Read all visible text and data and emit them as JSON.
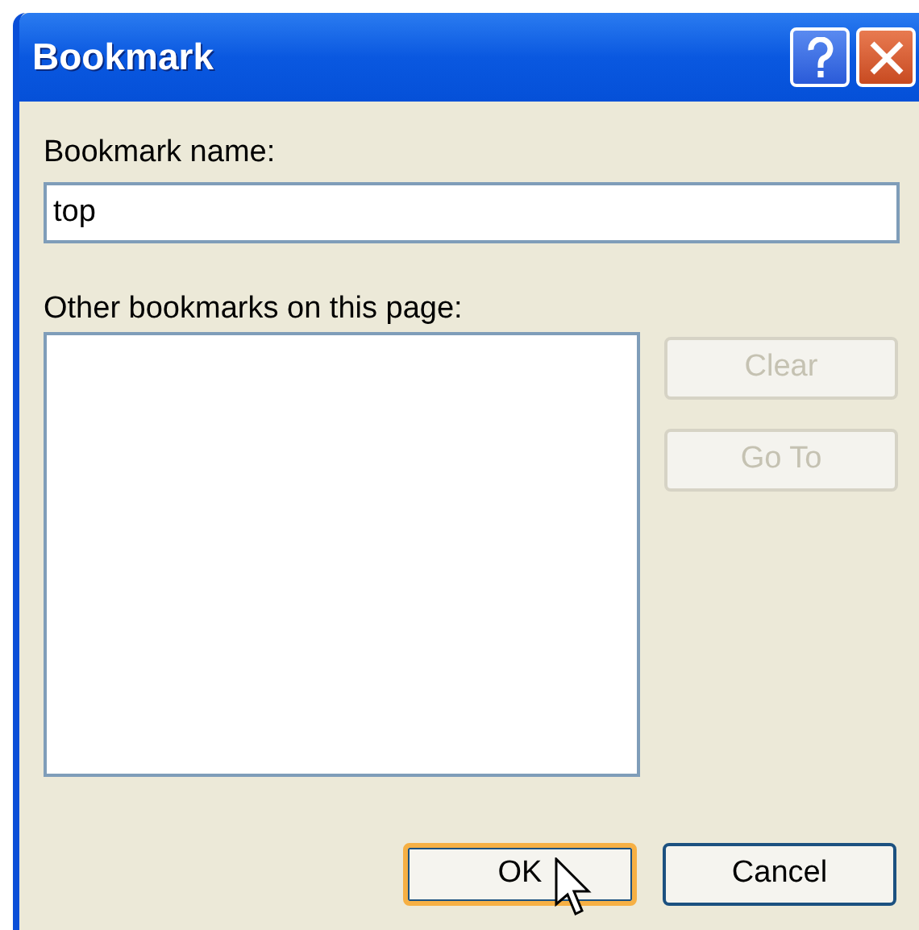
{
  "window": {
    "title": "Bookmark"
  },
  "name_field": {
    "label": "Bookmark name:",
    "value": "top"
  },
  "bookmark_list": {
    "label": "Other bookmarks on this page:"
  },
  "side_buttons": [
    {
      "label": "Clear",
      "disabled": true
    },
    {
      "label": "Go To",
      "disabled": true
    }
  ],
  "buttons": [
    {
      "label": "OK",
      "focused": true
    },
    {
      "label": "Cancel",
      "focused": false
    }
  ]
}
